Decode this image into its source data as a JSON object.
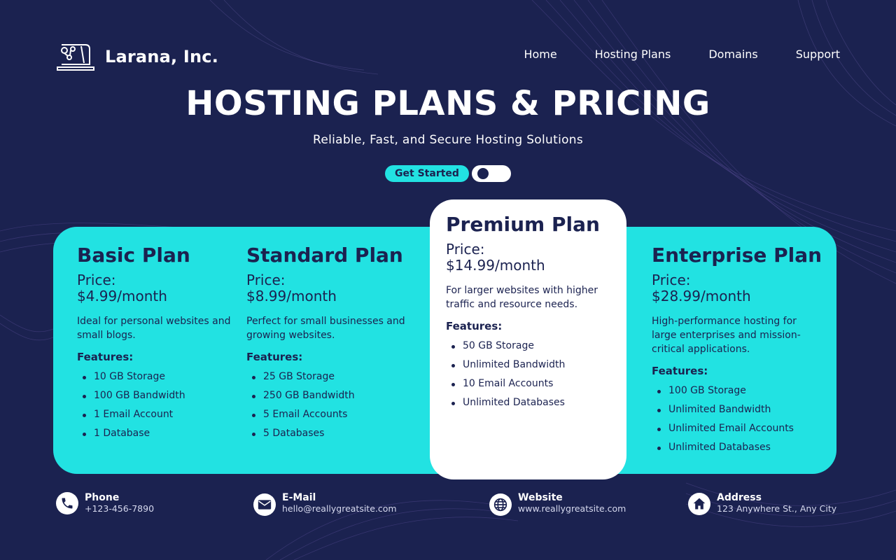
{
  "brand": {
    "name": "Larana, Inc.",
    "logo_icon": "laptop-gears-icon"
  },
  "nav": {
    "items": [
      "Home",
      "Hosting Plans",
      "Domains",
      "Support"
    ]
  },
  "hero": {
    "title": "HOSTING PLANS & PRICING",
    "subtitle": "Reliable, Fast, and Secure Hosting Solutions",
    "cta_label": "Get Started",
    "toggle_state": "off"
  },
  "plans": [
    {
      "name": "Basic Plan",
      "price_label": "Price:",
      "price": "$4.99/month",
      "description": "Ideal for personal websites and small blogs.",
      "features_title": "Features:",
      "features": [
        "10 GB Storage",
        "100 GB Bandwidth",
        "1 Email Account",
        "1 Database"
      ]
    },
    {
      "name": "Standard Plan",
      "price_label": "Price:",
      "price": "$8.99/month",
      "description": "Perfect for small businesses and growing websites.",
      "features_title": "Features:",
      "features": [
        "25 GB Storage",
        "250 GB Bandwidth",
        "5 Email Accounts",
        "5 Databases"
      ]
    },
    {
      "name": "Premium Plan",
      "price_label": "Price:",
      "price": "$14.99/month",
      "description": "For larger websites with higher traffic and resource needs.",
      "features_title": "Features:",
      "features": [
        "50 GB Storage",
        "Unlimited Bandwidth",
        "10 Email Accounts",
        "Unlimited Databases"
      ],
      "highlighted": true
    },
    {
      "name": "Enterprise Plan",
      "price_label": "Price:",
      "price": "$28.99/month",
      "description": "High-performance hosting for large enterprises and mission-critical applications.",
      "features_title": "Features:",
      "features": [
        "100 GB Storage",
        "Unlimited Bandwidth",
        "Unlimited Email Accounts",
        "Unlimited Databases"
      ]
    }
  ],
  "contacts": [
    {
      "label": "Phone",
      "value": "+123-456-7890",
      "icon": "phone-icon"
    },
    {
      "label": "E-Mail",
      "value": "hello@reallygreatsite.com",
      "icon": "mail-icon"
    },
    {
      "label": "Website",
      "value": "www.reallygreatsite.com",
      "icon": "globe-icon"
    },
    {
      "label": "Address",
      "value": "123 Anywhere St., Any City",
      "icon": "home-icon"
    }
  ],
  "colors": {
    "background": "#1b2250",
    "accent": "#22e2e2",
    "card": "#ffffff",
    "text_dark": "#1b2250"
  }
}
